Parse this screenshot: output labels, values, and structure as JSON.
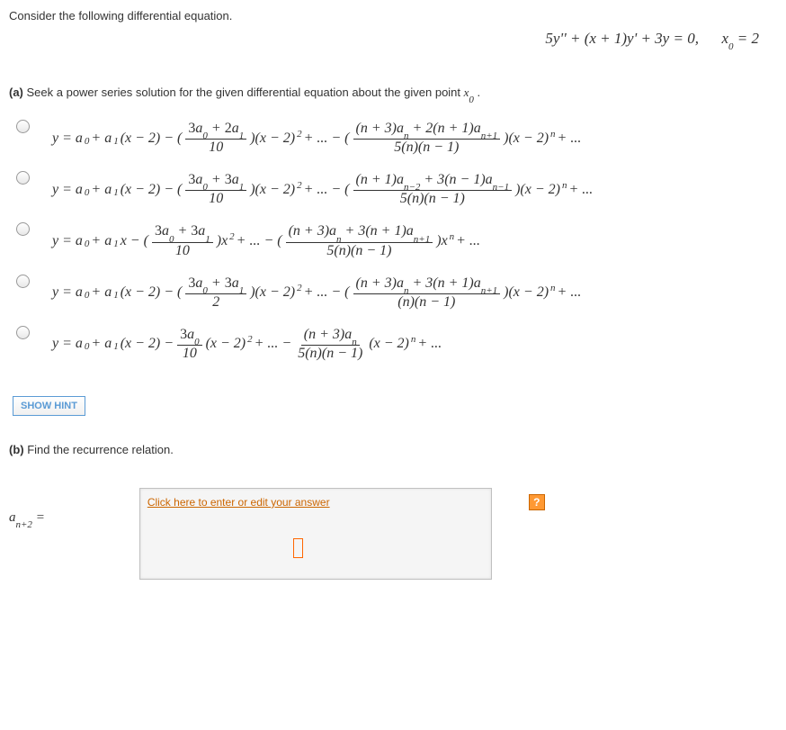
{
  "prompt": "Consider the following differential equation.",
  "equation": {
    "main": "5y'' + (x + 1)y' + 3y = 0,",
    "x0": "x",
    "x0sub": "0",
    "x0eq": " = 2"
  },
  "partA": {
    "label": "(a)",
    "text": " Seek a power series solution for the given differential equation about the given point ",
    "x0": "x",
    "x0sub": "0",
    "period": " ."
  },
  "options": [
    {
      "prefix": "y = a",
      "a0sub": "0",
      "plus": " + a",
      "a1sub": "1",
      "term1": "(x − 2) − (",
      "frac1_num": "3a₀ + 2a₁",
      "frac1_den": "10",
      "after1": ")(x − 2)",
      "sup1": "2",
      "mid": " + ... − (",
      "frac2_num_a": "(n + 3)a",
      "frac2_num_sub1": "n",
      "frac2_num_b": " + 2(n + 1)a",
      "frac2_num_sub2": "n+1",
      "frac2_den": "5(n)(n − 1)",
      "after2": ")(x − 2)",
      "sup2": "n",
      "tail": " + ..."
    },
    {
      "prefix": "y = a",
      "a0sub": "0",
      "plus": " + a",
      "a1sub": "1",
      "term1": "(x − 2) − (",
      "frac1_num": "3a₀ + 3a₁",
      "frac1_den": "10",
      "after1": ")(x − 2)",
      "sup1": "2",
      "mid": " + ... − (",
      "frac2_num_a": "(n + 1)a",
      "frac2_num_sub1": "n−2",
      "frac2_num_b": " + 3(n − 1)a",
      "frac2_num_sub2": "n−1",
      "frac2_den": "5(n)(n − 1)",
      "after2": ")(x − 2)",
      "sup2": "n",
      "tail": " + ..."
    },
    {
      "prefix": "y = a",
      "a0sub": "0",
      "plus": " + a",
      "a1sub": "1",
      "term1": "x − (",
      "frac1_num": "3a₀ + 3a₁",
      "frac1_den": "10",
      "after1": ")x",
      "sup1": "2",
      "mid": " + ... − (",
      "frac2_num_a": "(n + 3)a",
      "frac2_num_sub1": "n",
      "frac2_num_b": " + 3(n + 1)a",
      "frac2_num_sub2": "n+1",
      "frac2_den": "5(n)(n − 1)",
      "after2": ")x",
      "sup2": "n",
      "tail": " + ..."
    },
    {
      "prefix": "y = a",
      "a0sub": "0",
      "plus": " + a",
      "a1sub": "1",
      "term1": "(x − 2) − (",
      "frac1_num": "3a₀ + 3a₁",
      "frac1_den": "2",
      "after1": ")(x − 2)",
      "sup1": "2",
      "mid": " + ... − (",
      "frac2_num_a": "(n + 3)a",
      "frac2_num_sub1": "n",
      "frac2_num_b": " + 3(n + 1)a",
      "frac2_num_sub2": "n+1",
      "frac2_den": "(n)(n − 1)",
      "after2": ")(x − 2)",
      "sup2": "n",
      "tail": " + ..."
    },
    {
      "prefix": "y = a",
      "a0sub": "0",
      "plus": " + a",
      "a1sub": "1",
      "term1": "(x − 2) − ",
      "frac1_num": "3a₀",
      "frac1_den": "10",
      "after1": "(x − 2)",
      "sup1": "2",
      "mid": " + ... − ",
      "frac2_num_a": "(n + 3)a",
      "frac2_num_sub1": "n",
      "frac2_num_b": "",
      "frac2_num_sub2": "",
      "frac2_den": "5(n)(n − 1)",
      "after2": "(x − 2)",
      "sup2": "n",
      "tail": " + ..."
    }
  ],
  "showHint": "SHOW HINT",
  "partB": {
    "label": "(b)",
    "text": " Find the recurrence relation."
  },
  "answerLink": "Click here to enter or edit your answer",
  "anLabel": {
    "a": "a",
    "sub": "n+2",
    "eq": " ="
  },
  "helpIcon": "?"
}
